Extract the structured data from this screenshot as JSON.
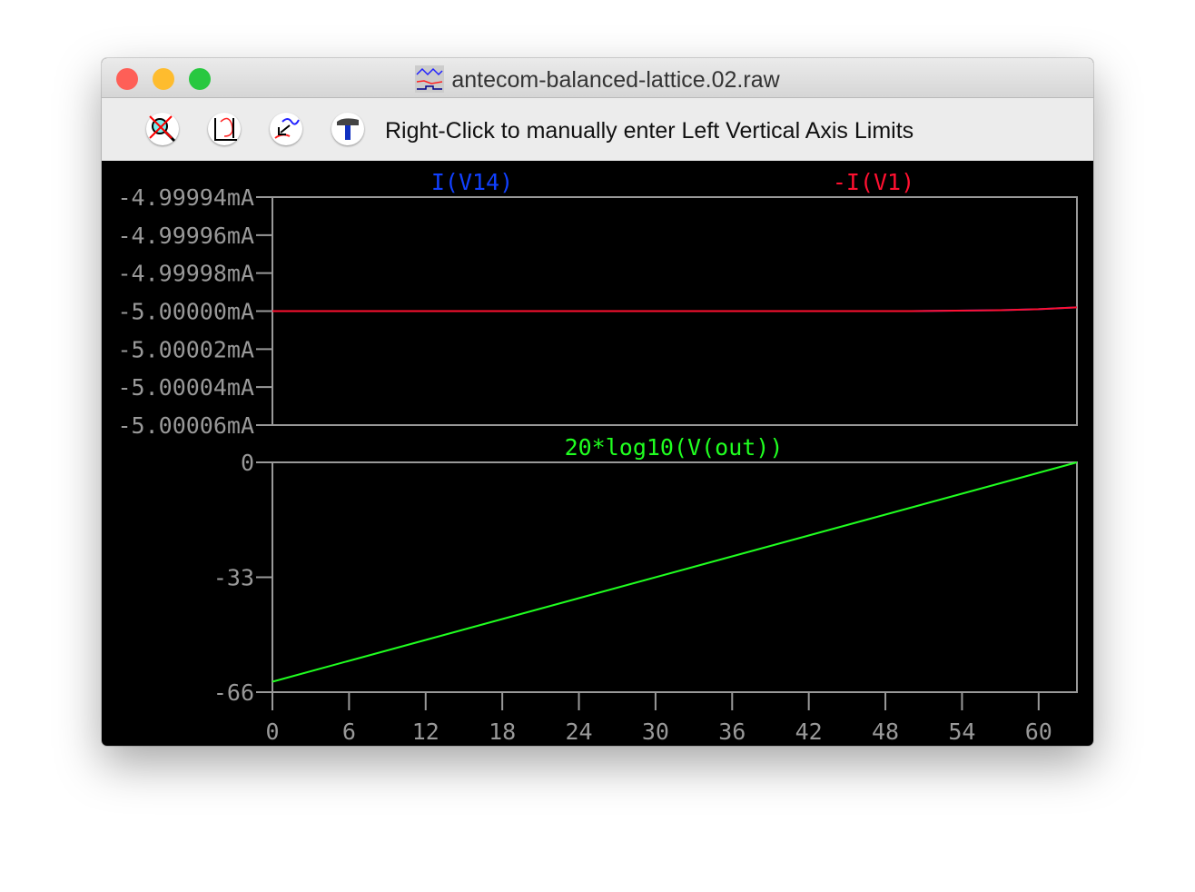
{
  "window": {
    "title": "antecom-balanced-lattice.02.raw",
    "title_icon": "waveform-icon"
  },
  "toolbar": {
    "buttons": [
      {
        "icon": "zoom-cancel-icon"
      },
      {
        "icon": "autorange-icon"
      },
      {
        "icon": "zoom-back-icon"
      },
      {
        "icon": "hammer-icon"
      }
    ],
    "hint": "Right-Click to manually enter Left Vertical Axis Limits"
  },
  "chart_data": [
    {
      "type": "line",
      "title": "",
      "ylabel": "",
      "ylim": [
        -5.00006,
        -4.99994
      ],
      "yticks": [
        "-4.99994mA",
        "-4.99996mA",
        "-4.99998mA",
        "-5.00000mA",
        "-5.00002mA",
        "-5.00004mA",
        "-5.00006mA"
      ],
      "series": [
        {
          "name": "I(V14)",
          "color": "#1040ff",
          "x": [
            0,
            30,
            50,
            57,
            60,
            63
          ],
          "y": [
            -5.0,
            -5.0,
            -5.0,
            -4.9999995,
            -4.999999,
            -4.999998
          ]
        },
        {
          "name": "-I(V1)",
          "color": "#ff1030",
          "x": [
            0,
            30,
            50,
            57,
            60,
            63
          ],
          "y": [
            -5.0,
            -5.0,
            -5.0,
            -4.9999995,
            -4.999999,
            -4.999998
          ]
        }
      ]
    },
    {
      "type": "line",
      "ylim": [
        -66,
        0
      ],
      "xlim": [
        0,
        63
      ],
      "yticks": [
        "0",
        "-33",
        "-66"
      ],
      "xticks": [
        "0",
        "6",
        "12",
        "18",
        "24",
        "30",
        "36",
        "42",
        "48",
        "54",
        "60"
      ],
      "series": [
        {
          "name": "20*log10(V(out))",
          "color": "#20ff20",
          "x": [
            0,
            63
          ],
          "y": [
            -63,
            0
          ]
        }
      ]
    }
  ]
}
